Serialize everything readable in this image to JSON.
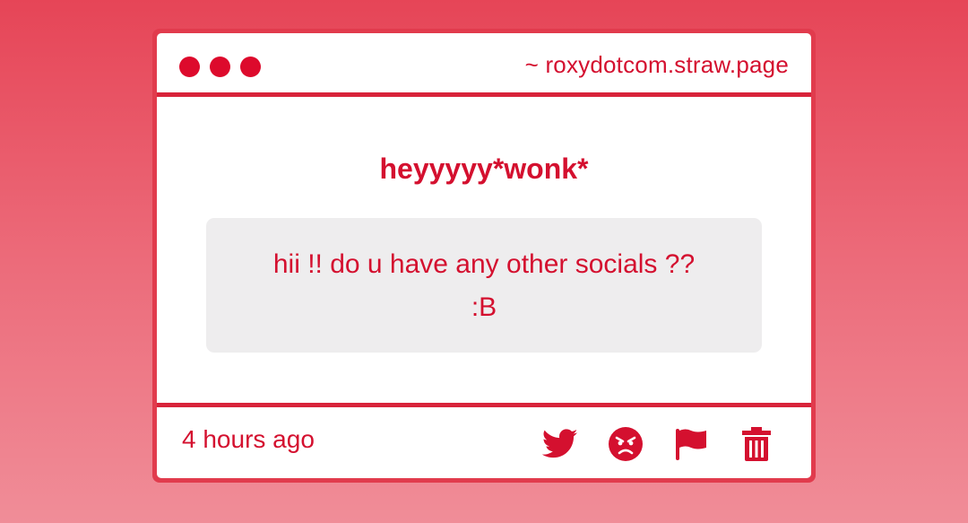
{
  "window": {
    "url": "~ roxydotcom.straw.page"
  },
  "post": {
    "title": "heyyyyy*wonk*",
    "message": "hii !! do u have any other socials ??\n:B"
  },
  "footer": {
    "timestamp": "4 hours ago",
    "actions": [
      {
        "icon": "twitter-icon"
      },
      {
        "icon": "angry-face-icon"
      },
      {
        "icon": "flag-icon"
      },
      {
        "icon": "trash-icon"
      }
    ]
  },
  "colors": {
    "accent": "#d4102f",
    "window_border": "#e13b4d",
    "message_bg": "#eeedee"
  }
}
